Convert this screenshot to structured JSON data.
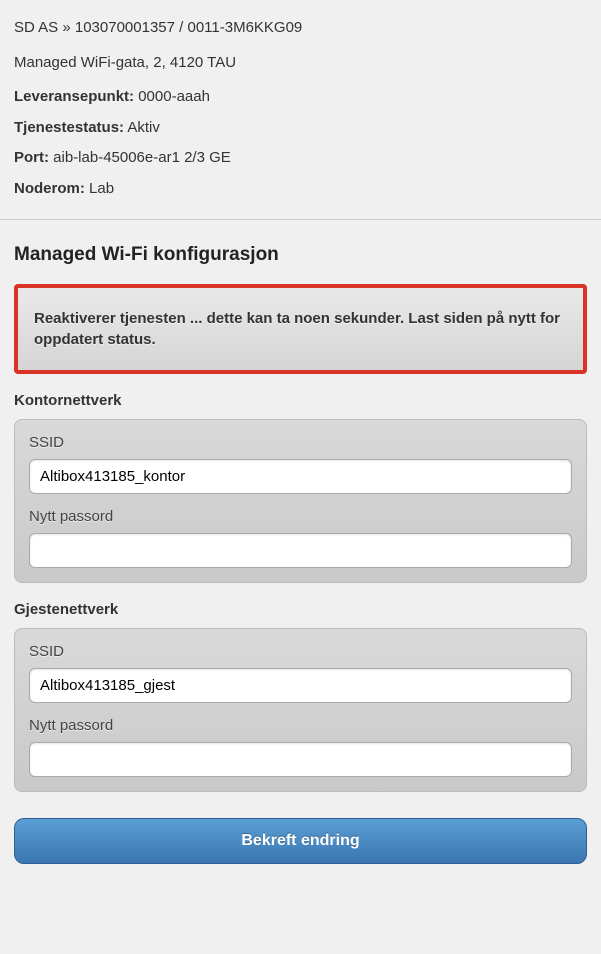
{
  "header": {
    "breadcrumb": "SD AS » 103070001357 / 0011-3M6KKG09",
    "address": "Managed WiFi-gata, 2, 4120 TAU",
    "leveransepunkt_label": "Leveransepunkt:",
    "leveransepunkt_value": " 0000-aaah",
    "tjenestestatus_label": "Tjenestestatus:",
    "tjenestestatus_value": " Aktiv",
    "port_label": "Port:",
    "port_value": " aib-lab-45006e-ar1 2/3 GE",
    "noderom_label": "Noderom:",
    "noderom_value": " Lab"
  },
  "config": {
    "title": "Managed Wi-Fi konfigurasjon",
    "alert": "Reaktiverer tjenesten ... dette kan ta noen sekunder. Last siden på nytt for oppdatert status.",
    "office": {
      "group_label": "Kontornettverk",
      "ssid_label": "SSID",
      "ssid_value": "Altibox413185_kontor",
      "password_label": "Nytt passord",
      "password_value": ""
    },
    "guest": {
      "group_label": "Gjestenettverk",
      "ssid_label": "SSID",
      "ssid_value": "Altibox413185_gjest",
      "password_label": "Nytt passord",
      "password_value": ""
    },
    "confirm_label": "Bekreft endring"
  }
}
